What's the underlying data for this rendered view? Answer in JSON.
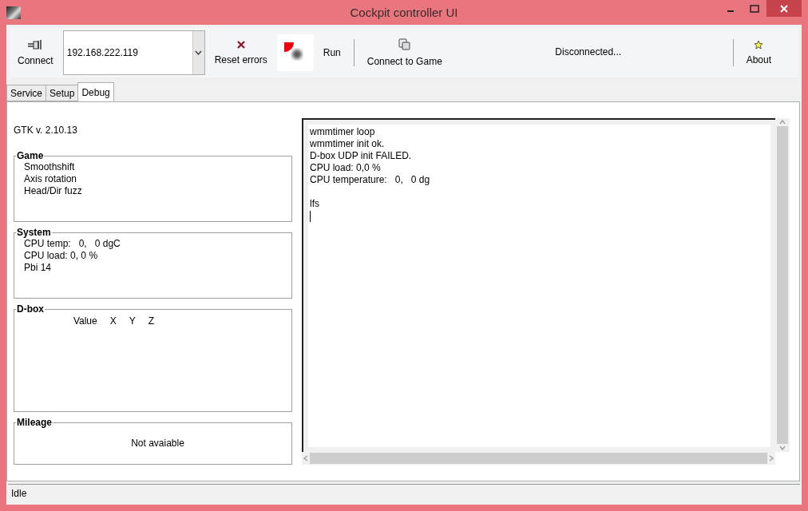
{
  "window": {
    "title": "Cockpit controller UI"
  },
  "toolbar": {
    "connect": "Connect",
    "address": "192.168.222.119",
    "reset_errors": "Reset errors",
    "run": "Run",
    "connect_game": "Connect to Game",
    "connection_status": "Disconnected...",
    "about": "About"
  },
  "tabs": [
    {
      "label": "Service",
      "selected": false
    },
    {
      "label": "Setup",
      "selected": false
    },
    {
      "label": "Debug",
      "selected": true
    }
  ],
  "version": "GTK v. 2.10.13",
  "groups": [
    {
      "title": "Game",
      "kind": "list",
      "lines": [
        "Smoothshift",
        "Axis rotation",
        "Head/Dir fuzz"
      ]
    },
    {
      "title": "System",
      "kind": "list",
      "lines": [
        "CPU temp:   0,   0 dgC",
        "CPU load: 0, 0 %",
        "Pbi 14"
      ]
    },
    {
      "title": "D-box",
      "kind": "columns",
      "lines": [
        "Value",
        "X",
        "Y",
        "Z"
      ]
    },
    {
      "title": "Mileage",
      "kind": "centered",
      "lines": [
        "Not avaiable"
      ]
    }
  ],
  "log": [
    [
      "wmmtimer loop",
      "wmmtimer init ok.",
      "D-box UDP init FAILED.",
      "CPU load: 0,0 %",
      "CPU temperature:   0,   0 dg"
    ],
    [
      "lfs"
    ]
  ],
  "status_bar": "Idle"
}
